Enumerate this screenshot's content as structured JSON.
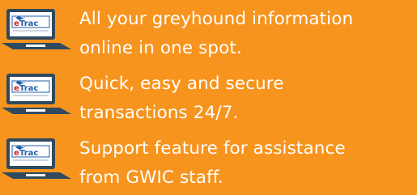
{
  "colors": {
    "background": "#f7941d",
    "text": "#ffffff",
    "laptop_body": "#2f4a5e",
    "logo_blue": "#1f5ea8",
    "logo_red": "#d4232a"
  },
  "features": [
    {
      "icon": "etrac-laptop-icon",
      "logo_text": "eTrac",
      "lines": [
        "All your greyhound information",
        "online in one spot."
      ]
    },
    {
      "icon": "etrac-laptop-icon",
      "logo_text": "eTrac",
      "lines": [
        "Quick, easy and secure",
        "transactions 24/7."
      ]
    },
    {
      "icon": "etrac-laptop-icon",
      "logo_text": "eTrac",
      "lines": [
        "Support feature for assistance",
        "from GWIC staff."
      ]
    }
  ]
}
